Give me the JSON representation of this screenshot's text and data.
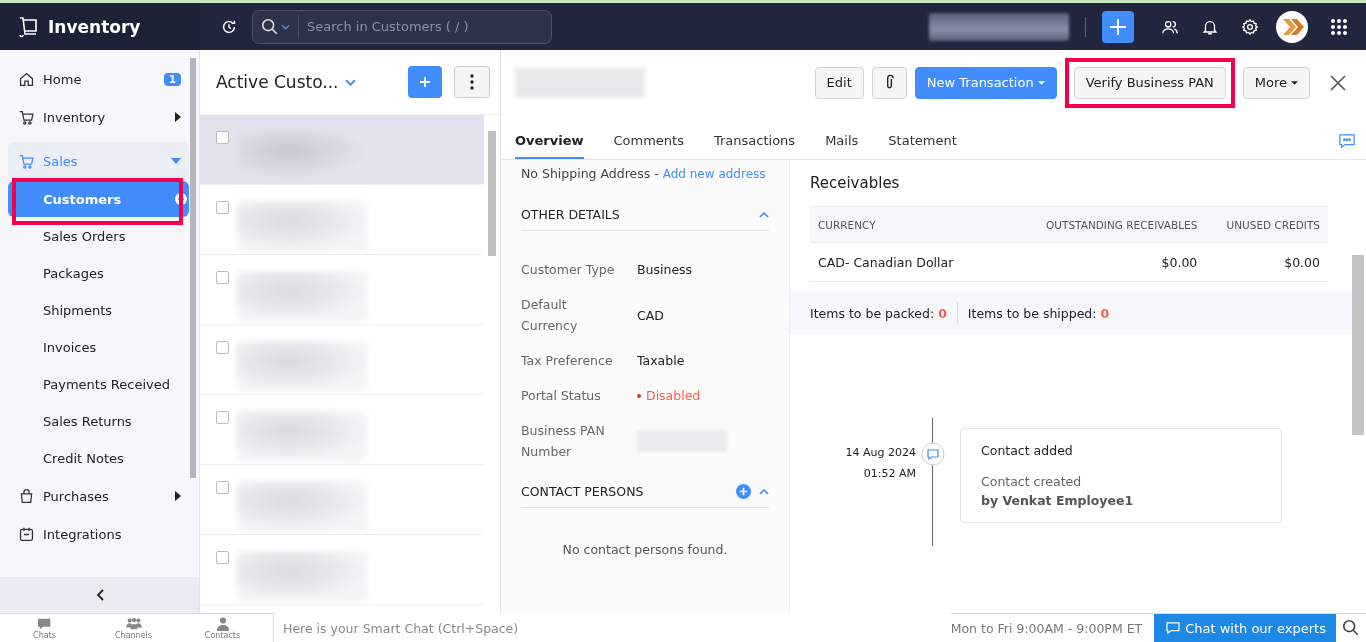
{
  "app": {
    "title": "Inventory",
    "search_placeholder": "Search in Customers ( / )"
  },
  "sidebar": {
    "items": [
      {
        "label": "Home",
        "badge": "1",
        "expanded": false
      },
      {
        "label": "Inventory",
        "arrow": true,
        "expanded": false
      },
      {
        "label": "Sales",
        "expanded": true,
        "children": [
          {
            "label": "Customers",
            "selected": true,
            "highlighted": true
          },
          {
            "label": "Sales Orders",
            "selected": false
          },
          {
            "label": "Packages",
            "selected": false
          },
          {
            "label": "Shipments",
            "selected": false
          },
          {
            "label": "Invoices",
            "selected": false
          },
          {
            "label": "Payments Received",
            "selected": false
          },
          {
            "label": "Sales Returns",
            "selected": false
          },
          {
            "label": "Credit Notes",
            "selected": false
          }
        ]
      },
      {
        "label": "Purchases",
        "arrow": true,
        "expanded": false
      },
      {
        "label": "Integrations",
        "expanded": false
      }
    ]
  },
  "list": {
    "title": "Active Custo...",
    "rows": [
      {
        "selected": true,
        "checked": false
      },
      {
        "selected": false,
        "checked": false
      },
      {
        "selected": false,
        "checked": false
      },
      {
        "selected": false,
        "checked": false
      },
      {
        "selected": false,
        "checked": false
      },
      {
        "selected": false,
        "checked": false
      },
      {
        "selected": false,
        "checked": false
      }
    ]
  },
  "detail": {
    "buttons": [
      {
        "kind": "plain",
        "label": "Edit"
      },
      {
        "kind": "attach"
      },
      {
        "kind": "primary",
        "label": "New Transaction"
      },
      {
        "kind": "plain",
        "label": "Verify Business PAN",
        "highlighted": true
      },
      {
        "kind": "dropdown",
        "label": "More"
      }
    ],
    "tabs": [
      {
        "label": "Overview",
        "selected": true
      },
      {
        "label": "Comments",
        "selected": false
      },
      {
        "label": "Transactions",
        "selected": false
      },
      {
        "label": "Mails",
        "selected": false
      },
      {
        "label": "Statement",
        "selected": false
      }
    ],
    "shipping": {
      "text": "No Shipping Address -",
      "link": "Add new address"
    },
    "other_details": {
      "title": "OTHER DETAILS",
      "expanded": true,
      "fields": [
        {
          "label": "Customer Type",
          "value": "Business",
          "kind": "text"
        },
        {
          "label": "Default Currency",
          "value": "CAD",
          "kind": "text"
        },
        {
          "label": "Tax Preference",
          "value": "Taxable",
          "kind": "text"
        },
        {
          "label": "Portal Status",
          "value": "Disabled",
          "kind": "status"
        },
        {
          "label": "Business PAN Number",
          "kind": "redacted"
        }
      ]
    },
    "contact_persons": {
      "title": "CONTACT PERSONS",
      "expanded": true,
      "empty": "No contact persons found."
    },
    "receivables": {
      "title": "Receivables",
      "columns": [
        "CURRENCY",
        "OUTSTANDING RECEIVABLES",
        "UNUSED CREDITS"
      ],
      "rows": [
        [
          "CAD- Canadian Dollar",
          "$0.00",
          "$0.00"
        ]
      ]
    },
    "packing": [
      {
        "label": "Items to be packed:",
        "count": "0"
      },
      {
        "label": "Items to be shipped:",
        "count": "0"
      }
    ],
    "timeline": [
      {
        "date": "14 Aug 2024",
        "time": "01:52 AM",
        "title": "Contact added",
        "text": "Contact created",
        "author": "by Venkat Employee1"
      }
    ]
  },
  "bottom_bar": {
    "tabs": [
      "Chats",
      "Channels",
      "Contacts"
    ],
    "chat_placeholder": "Here is your Smart Chat (Ctrl+Space)",
    "hours": "Mon to Fri 9:00AM - 9:00PM ET",
    "chat_button": "Chat with our experts"
  }
}
